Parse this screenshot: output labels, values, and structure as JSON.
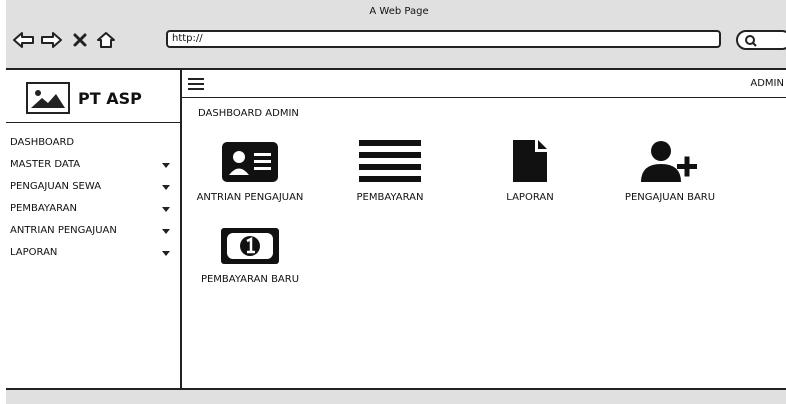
{
  "window": {
    "title": "A Web Page"
  },
  "browser": {
    "url": "http://",
    "nav_icons": [
      "back-arrow-icon",
      "forward-arrow-icon",
      "close-x-icon",
      "home-icon"
    ],
    "search_icon": "search-icon"
  },
  "sidebar": {
    "brand": "PT ASP",
    "items": [
      {
        "label": "DASHBOARD",
        "has_dropdown": false
      },
      {
        "label": "MASTER DATA",
        "has_dropdown": true
      },
      {
        "label": "PENGAJUAN SEWA",
        "has_dropdown": true
      },
      {
        "label": "PEMBAYARAN",
        "has_dropdown": true
      },
      {
        "label": "ANTRIAN PENGAJUAN",
        "has_dropdown": true
      },
      {
        "label": "LAPORAN",
        "has_dropdown": true
      }
    ]
  },
  "header": {
    "menu_icon": "hamburger-menu-icon",
    "user": "ADMIN"
  },
  "main": {
    "title": "DASHBOARD ADMIN",
    "tiles": [
      {
        "label": "ANTRIAN PENGAJUAN",
        "icon": "id-card-icon"
      },
      {
        "label": "PEMBAYARAN",
        "icon": "list-icon"
      },
      {
        "label": "LAPORAN",
        "icon": "document-icon"
      },
      {
        "label": "PENGAJUAN BARU",
        "icon": "add-user-icon"
      },
      {
        "label": "PEMBAYARAN BARU",
        "icon": "money-bill-icon"
      }
    ]
  },
  "colors": {
    "chrome": "#e0e0e0",
    "stroke": "#222222",
    "background": "#ffffff"
  }
}
